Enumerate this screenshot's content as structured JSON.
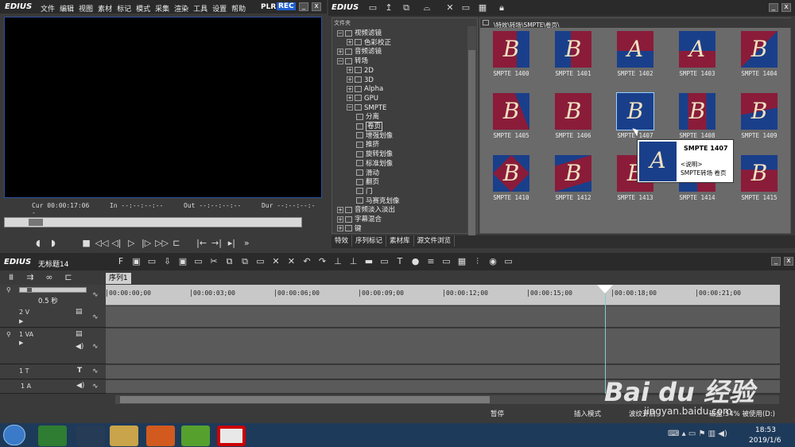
{
  "app": {
    "name": "EDIUS"
  },
  "menu": [
    "文件",
    "编辑",
    "视图",
    "素材",
    "标记",
    "模式",
    "采集",
    "渲染",
    "工具",
    "设置",
    "帮助"
  ],
  "player": {
    "mode_plr": "PLR",
    "mode_rec": "REC",
    "min": "_",
    "close": "x"
  },
  "timecodes": {
    "cur_label": "Cur",
    "cur": "00:00:17:06",
    "in_label": "In",
    "in": "--:--:--:--",
    "out_label": "Out",
    "out": "--:--:--:--",
    "dur_label": "Dur",
    "dur": "--:--:--:--"
  },
  "bin": {
    "title": "EDIUS",
    "folder_header": "文件夹",
    "path": "\\特效\\转场\\SMPTE\\卷页\\",
    "tree": [
      {
        "label": "视频滤镜",
        "level": 1,
        "expanded": true
      },
      {
        "label": "色彩校正",
        "level": 2
      },
      {
        "label": "音频滤镜",
        "level": 1
      },
      {
        "label": "转场",
        "level": 1,
        "expanded": true
      },
      {
        "label": "2D",
        "level": 2
      },
      {
        "label": "3D",
        "level": 2
      },
      {
        "label": "Alpha",
        "level": 2
      },
      {
        "label": "GPU",
        "level": 2
      },
      {
        "label": "SMPTE",
        "level": 2,
        "expanded": true
      },
      {
        "label": "分离",
        "level": 3
      },
      {
        "label": "卷页",
        "level": 3,
        "selected": true
      },
      {
        "label": "增强划像",
        "level": 3
      },
      {
        "label": "推挤",
        "level": 3
      },
      {
        "label": "旋转划像",
        "level": 3
      },
      {
        "label": "标准划像",
        "level": 3
      },
      {
        "label": "滑动",
        "level": 3
      },
      {
        "label": "翻页",
        "level": 3
      },
      {
        "label": "门",
        "level": 3
      },
      {
        "label": "马赛克划像",
        "level": 3
      },
      {
        "label": "音频淡入淡出",
        "level": 1
      },
      {
        "label": "字幕混合",
        "level": 1
      },
      {
        "label": "键",
        "level": 1
      }
    ],
    "tabs": [
      "特效",
      "序列标记",
      "素材库",
      "源文件浏览"
    ],
    "tiles": [
      "SMPTE 1400",
      "SMPTE 1401",
      "SMPTE 1402",
      "SMPTE 1403",
      "SMPTE 1404",
      "SMPTE 1405",
      "SMPTE 1406",
      "SMPTE 1407",
      "SMPTE 1408",
      "SMPTE 1409",
      "SMPTE 1410",
      "SMPTE 1412",
      "SMPTE 1413",
      "SMPTE 1414",
      "SMPTE 1415"
    ],
    "tooltip": {
      "title": "SMPTE 1407",
      "line1": "<说明>",
      "line2": "SMPTE转场 卷页"
    }
  },
  "timeline": {
    "app": "EDIUS",
    "project": "无标题14",
    "sequence_tab": "序列1",
    "zoom": "0.5 秒",
    "ruler": [
      "00:00:00;00",
      "00:00:03;00",
      "00:00:06;00",
      "00:00:09;00",
      "00:00:12;00",
      "00:00:15;00",
      "00:00:18;00",
      "00:00:21;00"
    ],
    "playhead_fraction": 0.74,
    "tracks": [
      {
        "label": "2 V"
      },
      {
        "label": "1 VA"
      },
      {
        "label": "1 T"
      },
      {
        "label": "1 A"
      }
    ],
    "status": [
      "暂停",
      "插入模式",
      "波纹开启",
      "磁盘:54% 被使用(D:)"
    ]
  },
  "taskbar": {
    "time": "18:53",
    "date": "2019/1/6"
  },
  "watermark": {
    "text": "Bai du 经验",
    "url": "jingyan.baidu.com"
  }
}
